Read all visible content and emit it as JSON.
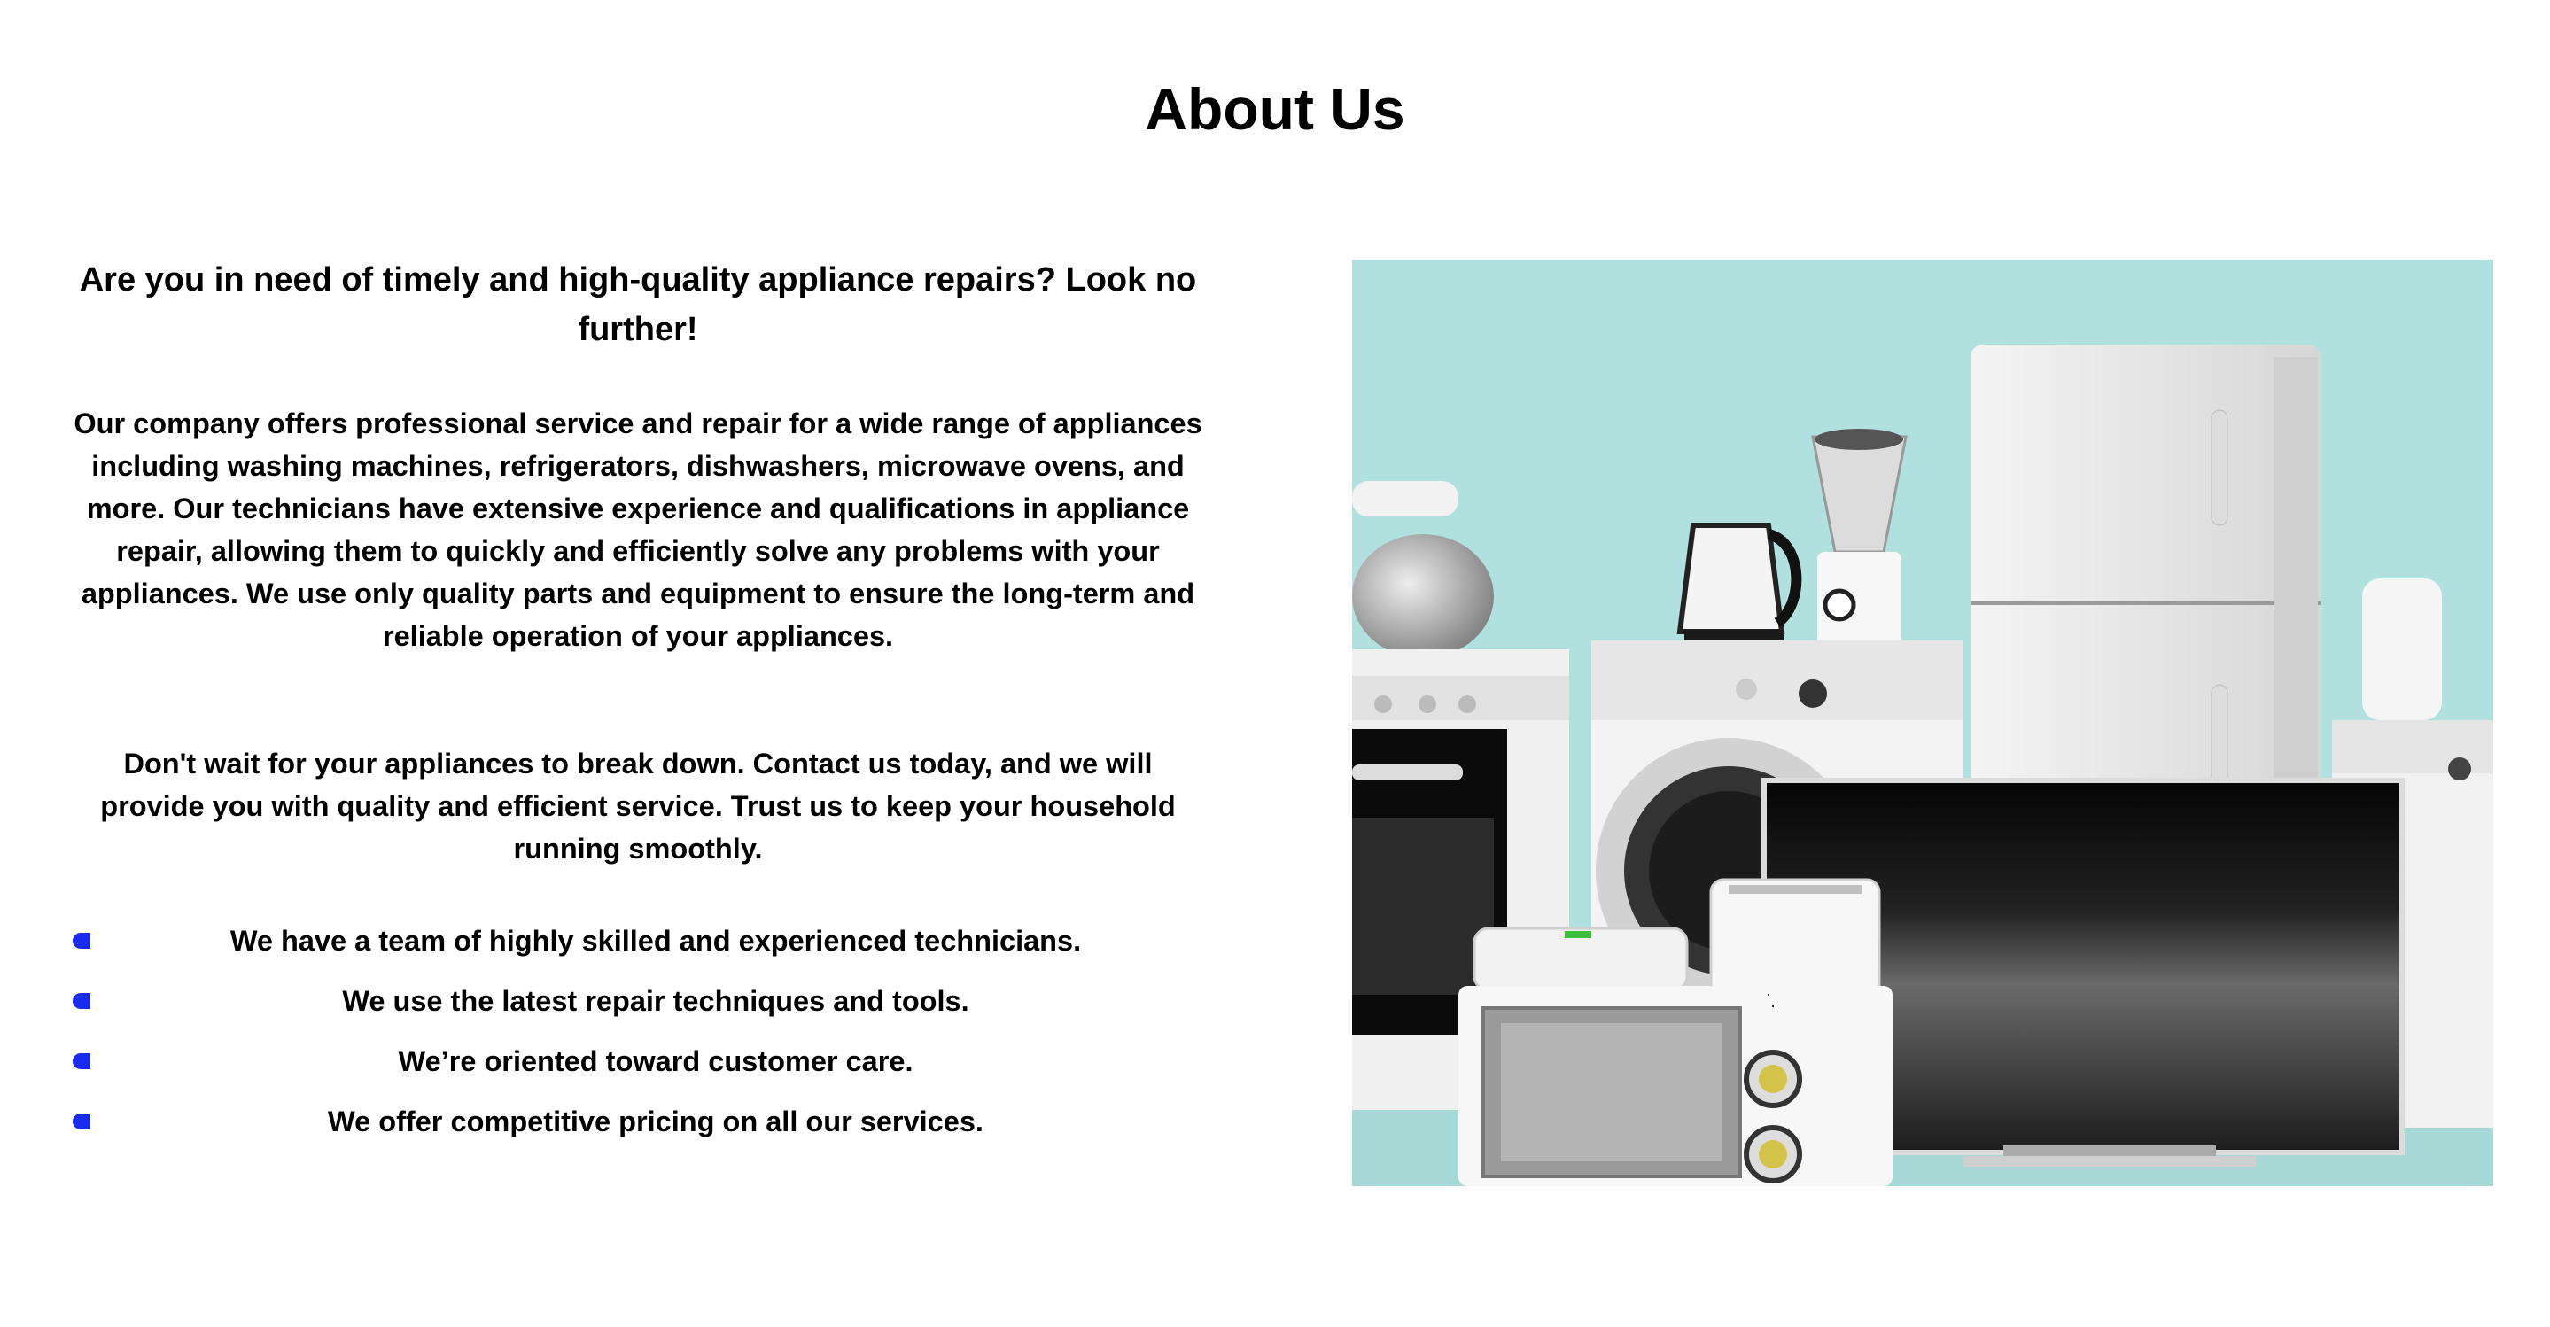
{
  "page": {
    "title": "About Us"
  },
  "about": {
    "lead": "Are you in need of timely and high-quality appliance repairs? Look no further!",
    "paragraph1": "Our company offers professional service and repair for a wide range of appliances including washing machines, refrigerators, dishwashers, microwave ovens, and more. Our technicians have extensive experience and qualifications in appliance repair, allowing them to quickly and efficiently solve any problems with your appliances. We use only quality parts and equipment to ensure the long-term and reliable operation of your appliances.",
    "paragraph2": "Don't wait for your appliances to break down. Contact us today, and we will provide you with quality and efficient service. Trust us to keep your household running smoothly.",
    "features": [
      "We have a team of highly skilled and experienced technicians.",
      "We use the latest repair techniques and tools.",
      "We’re oriented toward customer care.",
      "We offer competitive pricing on all our services."
    ]
  },
  "colors": {
    "bullet": "#1a2bf0",
    "image_background": "#b0e1df",
    "text": "#000000"
  },
  "icons": {
    "bullet": "bullet-icon"
  }
}
